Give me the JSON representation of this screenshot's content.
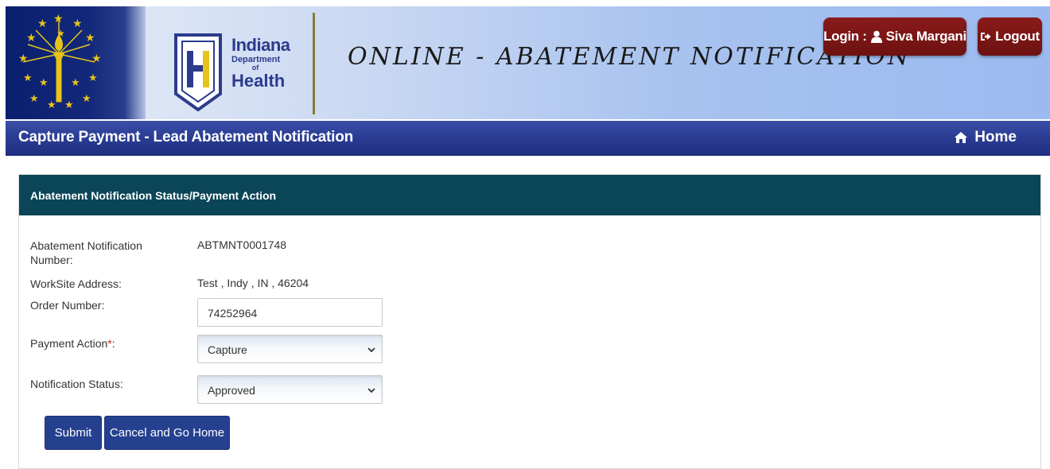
{
  "header": {
    "site_title": "ONLINE - ABATEMENT NOTIFICATION",
    "logo_line1": "Indiana",
    "logo_line2": "Department",
    "logo_line3": "of",
    "logo_line4": "Health",
    "login_prefix": "Login :",
    "user_name": "Siva Margani",
    "logout_label": "Logout",
    "colors": {
      "brand_red": "#7a1616",
      "brand_blue": "#2a3c92"
    }
  },
  "titlebar": {
    "title": "Capture Payment - Lead Abatement Notification",
    "home_label": "Home"
  },
  "panel": {
    "heading": "Abatement Notification Status/Payment Action",
    "fields": {
      "notification_number_label": "Abatement Notification Number:",
      "notification_number_value": "ABTMNT0001748",
      "worksite_label": "WorkSite Address:",
      "worksite_value": "Test , Indy , IN , 46204",
      "order_number_label": "Order Number:",
      "order_number_value": "74252964",
      "payment_action_label": "Payment Action",
      "payment_action_required": "*",
      "payment_action_colon": ":",
      "payment_action_value": "Capture",
      "notification_status_label": "Notification Status:",
      "notification_status_value": "Approved"
    },
    "buttons": {
      "submit": "Submit",
      "cancel": "Cancel and Go Home"
    },
    "colors": {
      "panel_header": "#0b4558",
      "button": "#25408f",
      "required": "#d01b1b"
    }
  },
  "icons": [
    "flag-torch-icon",
    "user-icon",
    "logout-icon",
    "home-icon",
    "chevron-down-icon"
  ]
}
